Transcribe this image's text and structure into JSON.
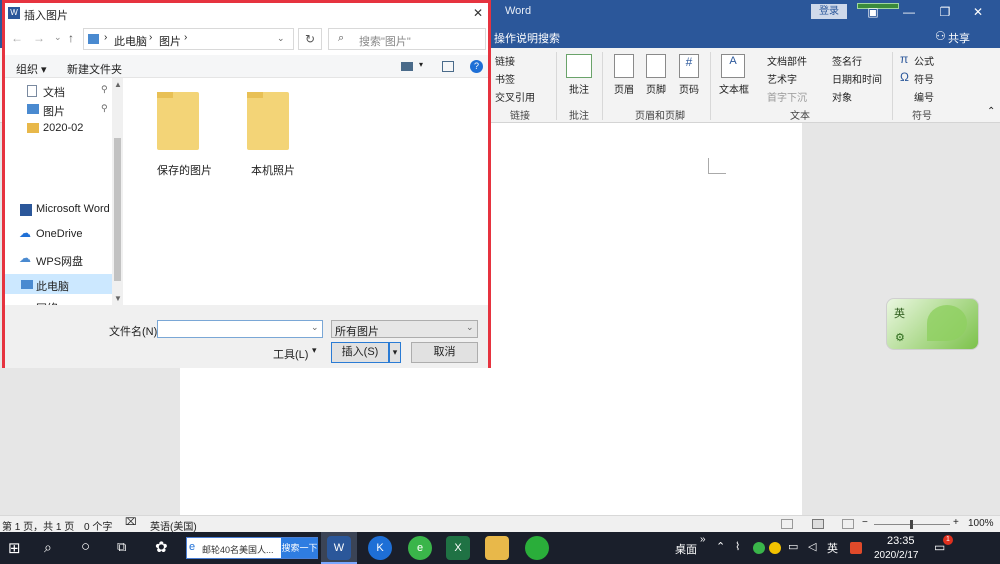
{
  "word": {
    "title": "Word",
    "signin": "登录",
    "tell_me": "操作说明搜索",
    "share": "共享"
  },
  "ribbon": {
    "links": [
      "链接",
      "书签",
      "交叉引用"
    ],
    "links_group": "链接",
    "comment": "批注",
    "comment_group": "批注",
    "header": "页眉",
    "footer": "页脚",
    "page_number": "页码",
    "hf_group": "页眉和页脚",
    "textbox": "文本框",
    "quick_parts": "文档部件",
    "wordart": "艺术字",
    "dropcap": "首字下沉",
    "signature": "签名行",
    "datetime": "日期和时间",
    "object": "对象",
    "text_group": "文本",
    "equation": "公式",
    "symbol": "符号",
    "number": "编号",
    "symbols_group": "符号"
  },
  "status": {
    "page": "第 1 页，共 1 页",
    "words": "0 个字",
    "lang": "英语(美国)",
    "zoom": "100%"
  },
  "taskbar": {
    "search_text": "邮轮40名美国人...",
    "search_btn": "搜索一下",
    "desktop": "桌面",
    "ime": "英",
    "time": "23:35",
    "date": "2020/2/17",
    "notif": "1"
  },
  "ime_widget": {
    "label": "英"
  },
  "dialog": {
    "title": "插入图片",
    "path": [
      "此电脑",
      "图片"
    ],
    "search_placeholder": "搜索\"图片\"",
    "organize": "组织 ▾",
    "new_folder": "新建文件夹",
    "nav": [
      "文档",
      "图片",
      "2020-02",
      "Microsoft Word",
      "OneDrive",
      "WPS网盘",
      "此电脑",
      "网络"
    ],
    "folders": [
      "保存的图片",
      "本机照片"
    ],
    "filename_label": "文件名(N):",
    "filename_value": "",
    "filetype": "所有图片",
    "tools": "工具(L)",
    "insert": "插入(S)",
    "cancel": "取消"
  },
  "colors": {
    "word_blue": "#2b579a",
    "dialog_border": "#e6333f",
    "folder": "#f3d477"
  }
}
